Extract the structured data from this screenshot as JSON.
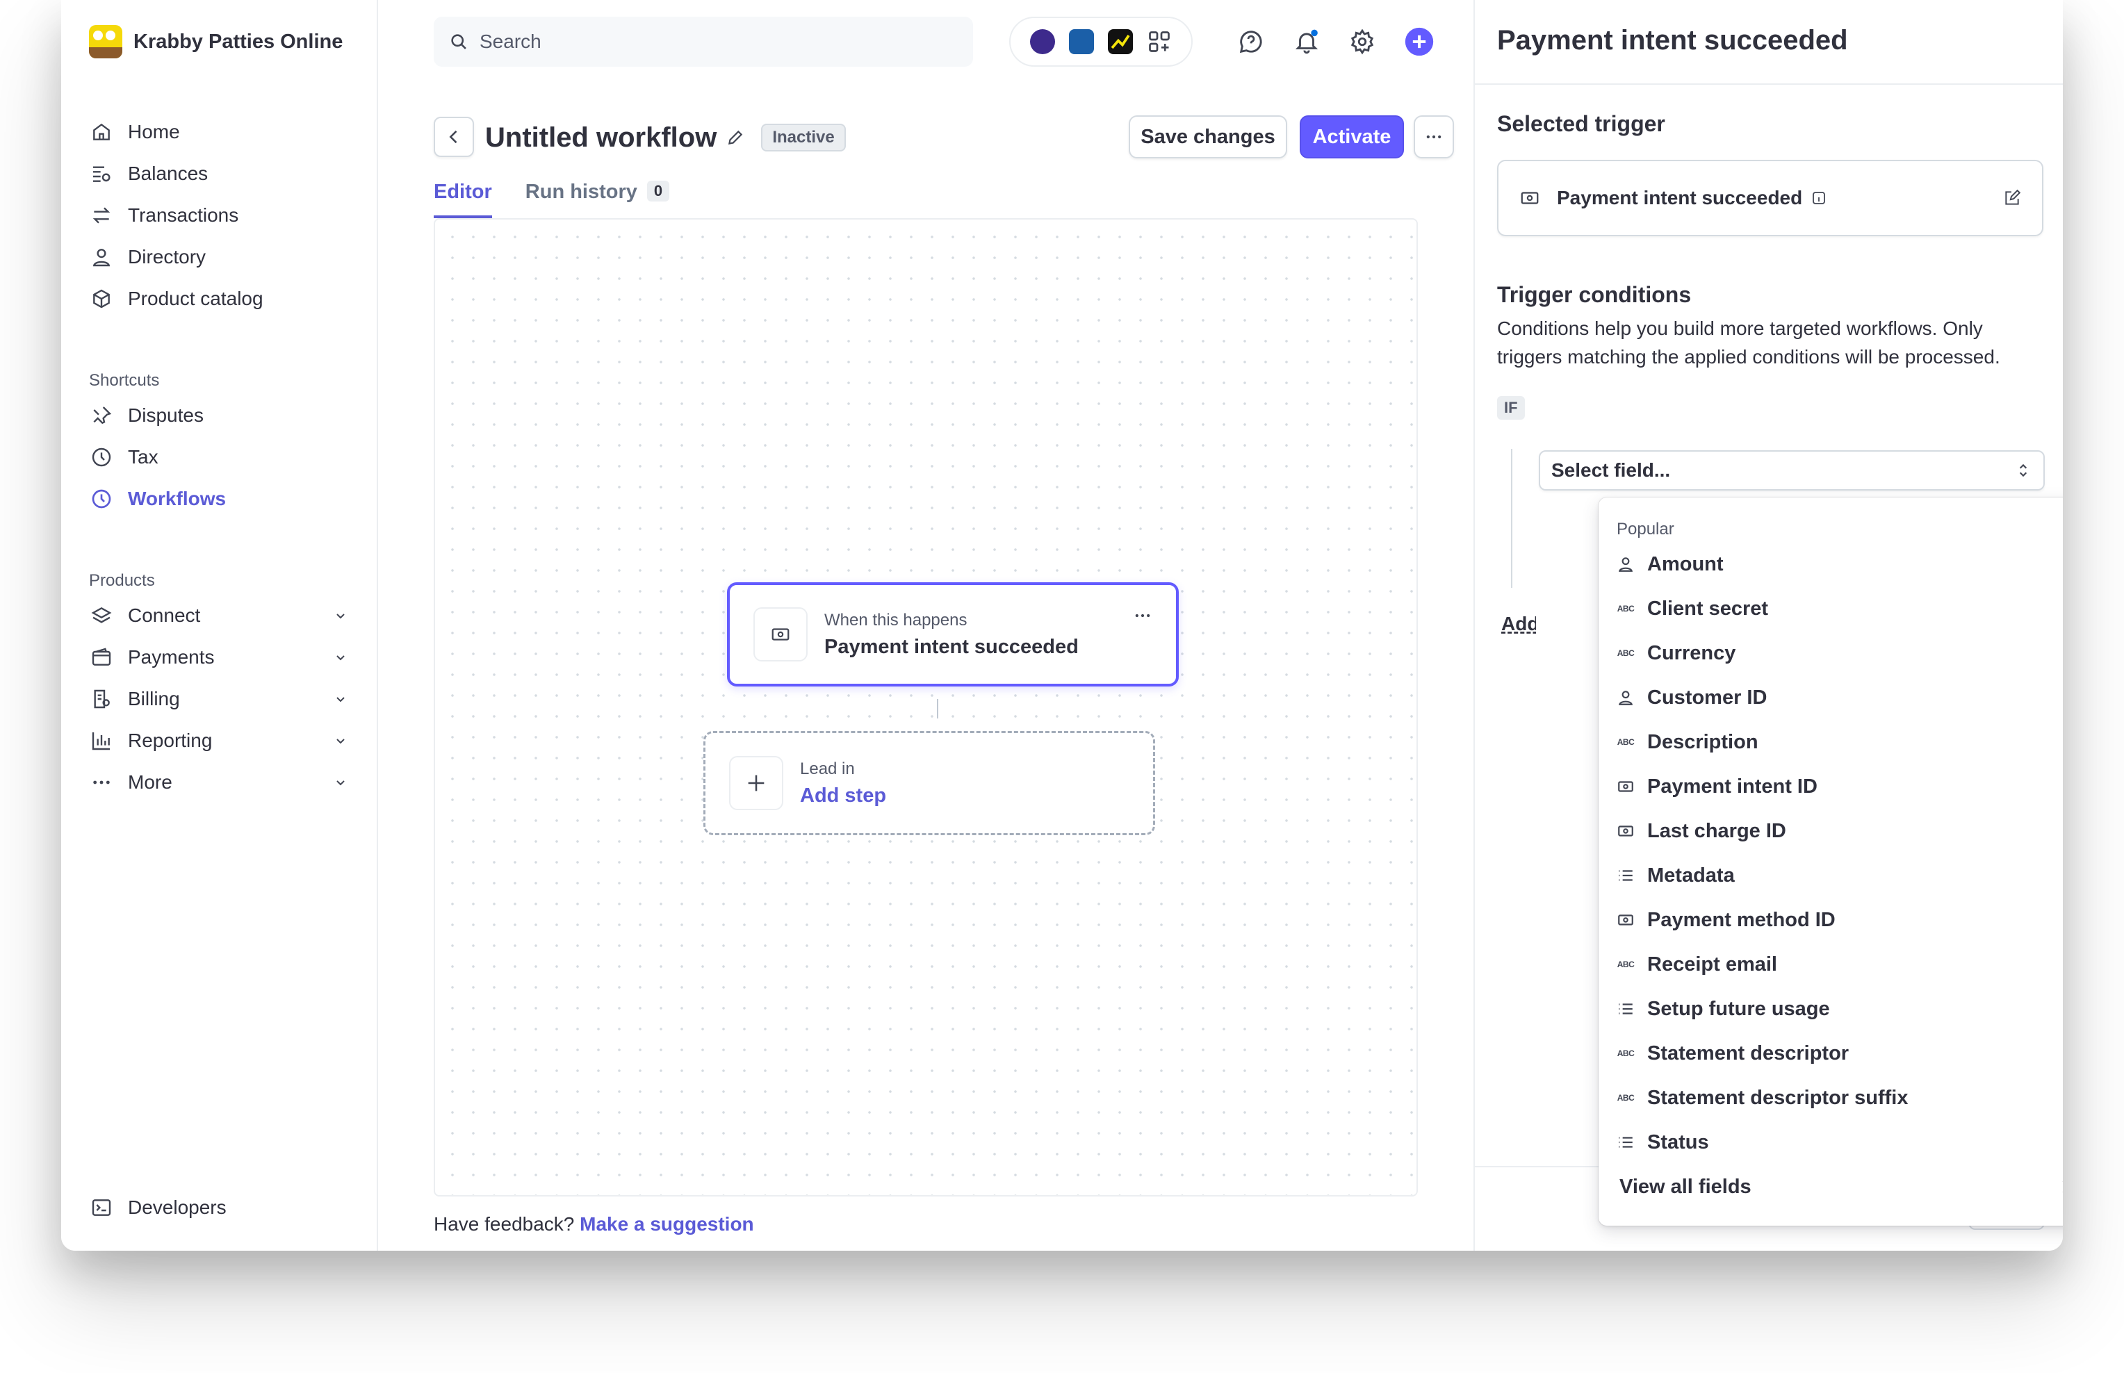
{
  "account": {
    "name": "Krabby Patties Online"
  },
  "sidebar": {
    "main": [
      {
        "label": "Home",
        "icon": "home-icon"
      },
      {
        "label": "Balances",
        "icon": "balances-icon"
      },
      {
        "label": "Transactions",
        "icon": "transactions-icon"
      },
      {
        "label": "Directory",
        "icon": "person-icon"
      },
      {
        "label": "Product catalog",
        "icon": "box-icon"
      }
    ],
    "shortcuts_heading": "Shortcuts",
    "shortcuts": [
      {
        "label": "Disputes",
        "icon": "pin-icon"
      },
      {
        "label": "Tax",
        "icon": "clock-icon"
      },
      {
        "label": "Workflows",
        "icon": "clock-icon",
        "active": true
      }
    ],
    "products_heading": "Products",
    "products": [
      {
        "label": "Connect",
        "icon": "layers-icon"
      },
      {
        "label": "Payments",
        "icon": "wallet-icon"
      },
      {
        "label": "Billing",
        "icon": "billing-icon"
      },
      {
        "label": "Reporting",
        "icon": "chart-icon"
      },
      {
        "label": "More",
        "icon": "dots-icon"
      }
    ],
    "developers": "Developers"
  },
  "search": {
    "placeholder": "Search"
  },
  "workflow": {
    "title": "Untitled workflow",
    "status": "Inactive",
    "save_label": "Save changes",
    "activate_label": "Activate",
    "tabs": [
      {
        "label": "Editor"
      },
      {
        "label": "Run history",
        "count": "0"
      }
    ],
    "trigger_node": {
      "caption": "When this happens",
      "title": "Payment intent succeeded"
    },
    "add_node": {
      "caption": "Lead in",
      "title": "Add step"
    },
    "feedback_text": "Have feedback?",
    "feedback_link": "Make a suggestion"
  },
  "panel": {
    "title": "Payment intent succeeded",
    "selected_trigger_heading": "Selected trigger",
    "selected_trigger": "Payment intent succeeded",
    "conditions_heading": "Trigger conditions",
    "conditions_desc": "Conditions help you build more targeted workflows. Only triggers matching the applied conditions will be processed.",
    "if_label": "IF",
    "select_placeholder": "Select field...",
    "add_condition": "Add condition"
  },
  "dropdown": {
    "group": "Popular",
    "items": [
      {
        "label": "Amount",
        "icon": "person-icon"
      },
      {
        "label": "Client secret",
        "icon": "abc-icon"
      },
      {
        "label": "Currency",
        "icon": "abc-icon"
      },
      {
        "label": "Customer ID",
        "icon": "person-icon"
      },
      {
        "label": "Description",
        "icon": "abc-icon"
      },
      {
        "label": "Payment intent ID",
        "icon": "money-icon"
      },
      {
        "label": "Last charge ID",
        "icon": "money-icon"
      },
      {
        "label": "Metadata",
        "icon": "list-icon"
      },
      {
        "label": "Payment method ID",
        "icon": "money-icon"
      },
      {
        "label": "Receipt email",
        "icon": "abc-icon"
      },
      {
        "label": "Setup future usage",
        "icon": "list-icon"
      },
      {
        "label": "Statement descriptor",
        "icon": "abc-icon"
      },
      {
        "label": "Statement descriptor suffix",
        "icon": "abc-icon"
      },
      {
        "label": "Status",
        "icon": "list-icon"
      }
    ],
    "view_all": "View all fields",
    "abc_glyph": "ABC"
  },
  "colors": {
    "accent": "#635bff",
    "active_text": "#5b5bd6",
    "text": "#30313d",
    "muted": "#545969",
    "border": "#d5dbe1"
  }
}
